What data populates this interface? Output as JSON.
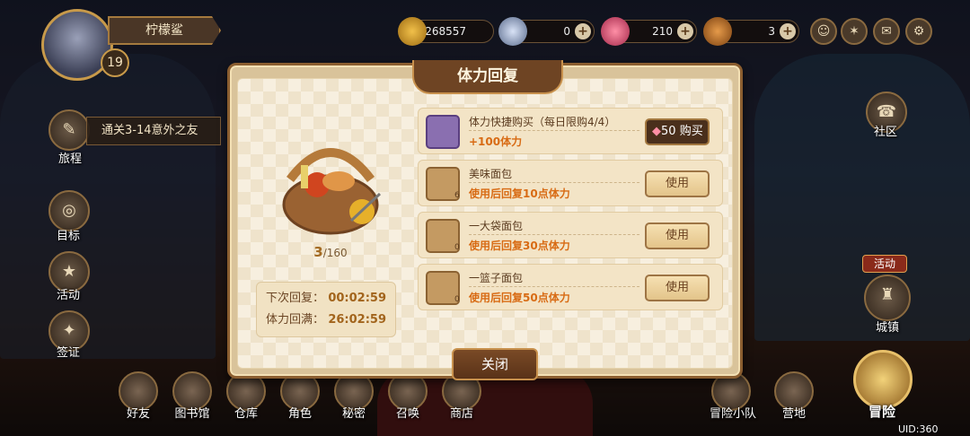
{
  "player": {
    "name": "柠檬鲨",
    "level": "19"
  },
  "resources": [
    {
      "icon": "gold-coin-icon",
      "value": "268557",
      "plus": false
    },
    {
      "icon": "diamond-icon",
      "value": "0",
      "plus": true
    },
    {
      "icon": "red-crystal-icon",
      "value": "210",
      "plus": true
    },
    {
      "icon": "bread-icon",
      "value": "3",
      "plus": true
    }
  ],
  "quest": {
    "text": "通关3-14意外之友",
    "label": "旅程"
  },
  "left_menu": [
    "目标",
    "活动",
    "签证"
  ],
  "right_menu": {
    "community": "社区",
    "activity_badge": "活动",
    "town": "城镇"
  },
  "bottom_nav": [
    "好友",
    "图书馆",
    "仓库",
    "角色",
    "秘密",
    "召唤",
    "商店",
    "冒险小队",
    "营地",
    "冒险"
  ],
  "uid": "UID:360",
  "modal": {
    "title": "体力回复",
    "stamina_current": "3",
    "stamina_max": "/160",
    "next_label": "下次回复：",
    "next_time": "00:02:59",
    "full_label": "体力回满：",
    "full_time": "26:02:59",
    "close_label": "关闭",
    "items": [
      {
        "name": "体力快捷购买（每日限购4/4）",
        "desc": "+100体力",
        "count": "",
        "action": "购买",
        "price": "50",
        "type": "buy",
        "icon": "red-crystal-icon"
      },
      {
        "name": "美味面包",
        "desc": "使用后回复10点体力",
        "count": "6",
        "action": "使用",
        "type": "use",
        "icon": "bread-icon"
      },
      {
        "name": "一大袋面包",
        "desc": "使用后回复30点体力",
        "count": "0",
        "action": "使用",
        "type": "use",
        "icon": "bread-bag-icon"
      },
      {
        "name": "一篮子面包",
        "desc": "使用后回复50点体力",
        "count": "0",
        "action": "使用",
        "type": "use",
        "icon": "bread-basket-icon"
      }
    ]
  }
}
